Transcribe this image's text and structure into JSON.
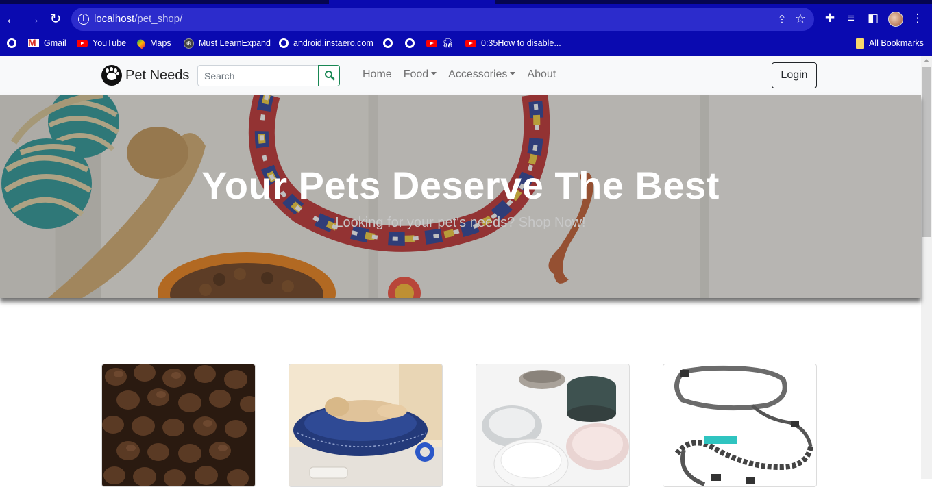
{
  "browser": {
    "url_host": "localhost",
    "url_path": "/pet_shop/",
    "nav_icons": [
      "back-arrow-icon",
      "forward-arrow-icon",
      "reload-icon"
    ],
    "bookmarks": [
      {
        "label": "",
        "icon": "globe-icon"
      },
      {
        "label": "Gmail",
        "icon": "gmail-icon"
      },
      {
        "label": "YouTube",
        "icon": "youtube-icon"
      },
      {
        "label": "Maps",
        "icon": "maps-icon"
      },
      {
        "label": "Must LearnExpand",
        "icon": "site-icon"
      },
      {
        "label": "android.instaero.com",
        "icon": "globe-icon"
      },
      {
        "label": "",
        "icon": "globe-icon"
      },
      {
        "label": "",
        "icon": "globe-icon"
      },
      {
        "label": "",
        "icon": "youtube-icon"
      },
      {
        "label": "0:35How to disable...",
        "icon": "youtube-icon"
      },
      {
        "label": "All Bookmarks",
        "icon": "folder-icon"
      }
    ]
  },
  "navbar": {
    "brand": "Pet Needs",
    "search_placeholder": "Search",
    "menu": [
      {
        "label": "Home",
        "dropdown": false
      },
      {
        "label": "Food",
        "dropdown": true
      },
      {
        "label": "Accessories",
        "dropdown": true
      },
      {
        "label": "About",
        "dropdown": false
      }
    ],
    "login_label": "Login"
  },
  "hero": {
    "title": "Your Pets Deserve The Best",
    "subtitle": "Looking for your pet's needs? Shop Now!"
  },
  "products": [
    {
      "image": "dry-kibble-food"
    },
    {
      "image": "dog-on-blue-bed"
    },
    {
      "image": "ceramic-pet-bowls"
    },
    {
      "image": "hands-free-dog-leash"
    }
  ],
  "colors": {
    "browser_chrome": "#0a0ab0",
    "navbar_bg": "#f8f9fa",
    "search_accent": "#198754"
  }
}
